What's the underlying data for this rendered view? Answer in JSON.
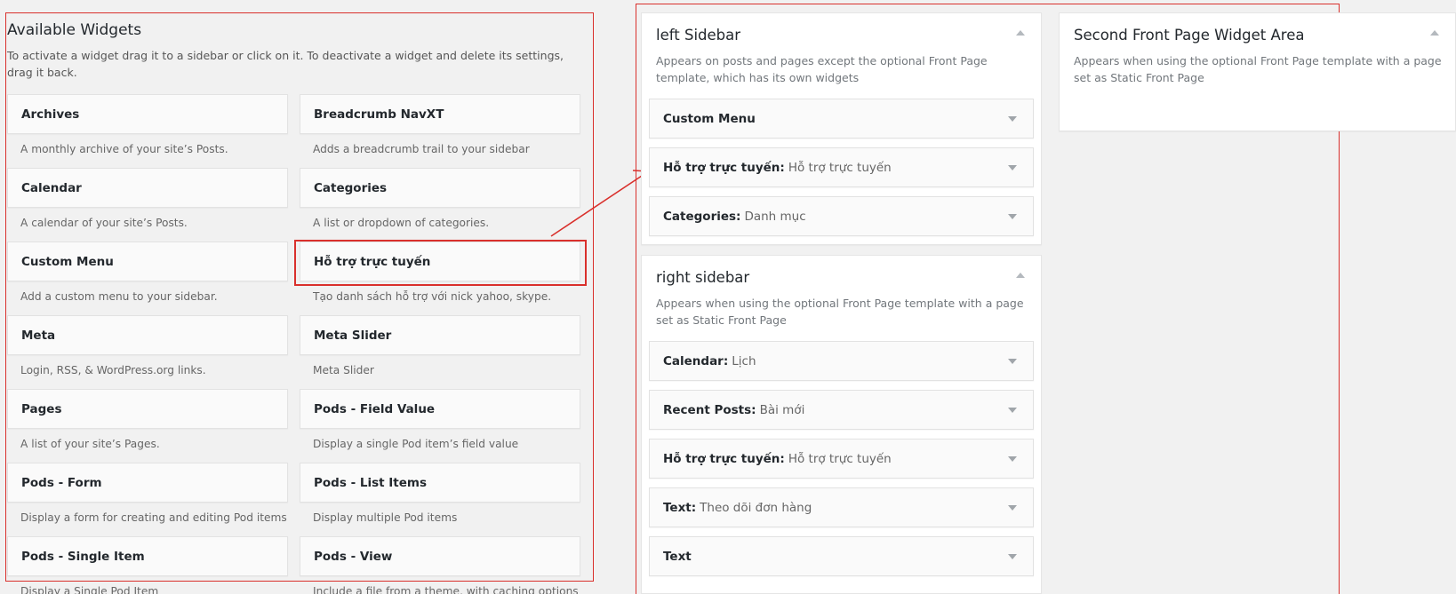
{
  "available": {
    "title": "Available Widgets",
    "description": "To activate a widget drag it to a sidebar or click on it. To deactivate a widget and delete its settings, drag it back.",
    "widgets": [
      {
        "name": "Archives",
        "desc": "A monthly archive of your site’s Posts."
      },
      {
        "name": "Breadcrumb NavXT",
        "desc": "Adds a breadcrumb trail to your sidebar"
      },
      {
        "name": "Calendar",
        "desc": "A calendar of your site’s Posts."
      },
      {
        "name": "Categories",
        "desc": "A list or dropdown of categories."
      },
      {
        "name": "Custom Menu",
        "desc": "Add a custom menu to your sidebar."
      },
      {
        "name": "Hỗ trợ trực tuyến",
        "desc": "Tạo danh sách hỗ trợ với nick yahoo, skype."
      },
      {
        "name": "Meta",
        "desc": "Login, RSS, & WordPress.org links."
      },
      {
        "name": "Meta Slider",
        "desc": "Meta Slider"
      },
      {
        "name": "Pages",
        "desc": "A list of your site’s Pages."
      },
      {
        "name": "Pods - Field Value",
        "desc": "Display a single Pod item’s field value"
      },
      {
        "name": "Pods - Form",
        "desc": "Display a form for creating and editing Pod items"
      },
      {
        "name": "Pods - List Items",
        "desc": "Display multiple Pod items"
      },
      {
        "name": "Pods - Single Item",
        "desc": "Display a Single Pod Item"
      },
      {
        "name": "Pods - View",
        "desc": "Include a file from a theme, with caching options"
      }
    ]
  },
  "left_sidebar": {
    "title": "left Sidebar",
    "description": "Appears on posts and pages except the optional Front Page template, which has its own widgets",
    "widgets": [
      {
        "name": "Custom Menu",
        "title": ""
      },
      {
        "name": "Hỗ trợ trực tuyến:",
        "title": "Hỗ trợ trực tuyến"
      },
      {
        "name": "Categories:",
        "title": "Danh mục"
      }
    ]
  },
  "right_sidebar": {
    "title": "right sidebar",
    "description": "Appears when using the optional Front Page template with a page set as Static Front Page",
    "widgets": [
      {
        "name": "Calendar:",
        "title": "Lịch"
      },
      {
        "name": "Recent Posts:",
        "title": "Bài mới"
      },
      {
        "name": "Hỗ trợ trực tuyến:",
        "title": "Hỗ trợ trực tuyến"
      },
      {
        "name": "Text:",
        "title": "Theo dõi đơn hàng"
      },
      {
        "name": "Text",
        "title": ""
      }
    ]
  },
  "second_front": {
    "title": "Second Front Page Widget Area",
    "description": "Appears when using the optional Front Page template with a page set as Static Front Page"
  },
  "colors": {
    "annotation": "#d9302c",
    "background": "#f1f1f1"
  },
  "icons": {
    "panel_toggle": "arrow-up-icon",
    "widget_toggle": "arrow-down-icon",
    "annotation_arrow": "red-arrow"
  }
}
